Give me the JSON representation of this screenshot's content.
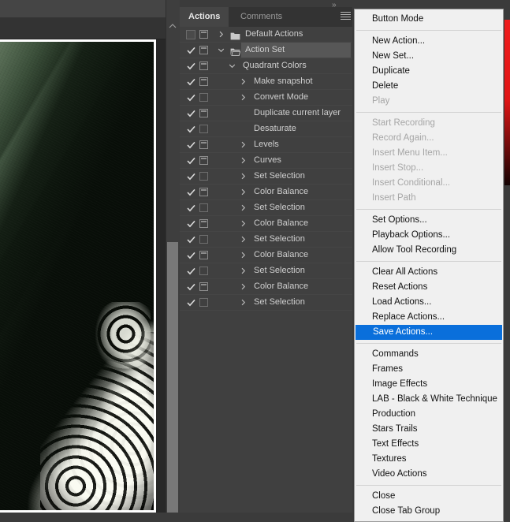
{
  "document": {
    "name": "photoshop-canvas",
    "image_description": "dark green-tinted photograph of angled architectural panels with a lit lattice window"
  },
  "panel": {
    "overflow_icon": "chevron-double-right-icon",
    "menu_icon": "hamburger-menu-icon",
    "tabs": [
      {
        "label": "Actions",
        "active": true
      },
      {
        "label": "Comments",
        "active": false
      }
    ],
    "rows": [
      {
        "label": "Default Actions",
        "depth": 0,
        "checked": false,
        "dialog": "filled",
        "arrow": "right",
        "folder": "closed",
        "selected": false
      },
      {
        "label": "Action Set",
        "depth": 0,
        "checked": true,
        "dialog": "filled",
        "arrow": "down",
        "folder": "open",
        "selected": true
      },
      {
        "label": "Quadrant Colors",
        "depth": 1,
        "checked": true,
        "dialog": "filled",
        "arrow": "down",
        "folder": "none",
        "selected": false
      },
      {
        "label": "Make snapshot",
        "depth": 2,
        "checked": true,
        "dialog": "filled",
        "arrow": "right",
        "folder": "none",
        "selected": false
      },
      {
        "label": "Convert Mode",
        "depth": 2,
        "checked": true,
        "dialog": "empty",
        "arrow": "right",
        "folder": "none",
        "selected": false
      },
      {
        "label": "Duplicate current layer",
        "depth": 2,
        "checked": true,
        "dialog": "filled",
        "arrow": "none",
        "folder": "none",
        "selected": false
      },
      {
        "label": "Desaturate",
        "depth": 2,
        "checked": true,
        "dialog": "empty",
        "arrow": "none",
        "folder": "none",
        "selected": false
      },
      {
        "label": "Levels",
        "depth": 2,
        "checked": true,
        "dialog": "filled",
        "arrow": "right",
        "folder": "none",
        "selected": false
      },
      {
        "label": "Curves",
        "depth": 2,
        "checked": true,
        "dialog": "filled",
        "arrow": "right",
        "folder": "none",
        "selected": false
      },
      {
        "label": "Set Selection",
        "depth": 2,
        "checked": true,
        "dialog": "empty",
        "arrow": "right",
        "folder": "none",
        "selected": false
      },
      {
        "label": "Color Balance",
        "depth": 2,
        "checked": true,
        "dialog": "filled",
        "arrow": "right",
        "folder": "none",
        "selected": false
      },
      {
        "label": "Set Selection",
        "depth": 2,
        "checked": true,
        "dialog": "empty",
        "arrow": "right",
        "folder": "none",
        "selected": false
      },
      {
        "label": "Color Balance",
        "depth": 2,
        "checked": true,
        "dialog": "filled",
        "arrow": "right",
        "folder": "none",
        "selected": false
      },
      {
        "label": "Set Selection",
        "depth": 2,
        "checked": true,
        "dialog": "empty",
        "arrow": "right",
        "folder": "none",
        "selected": false
      },
      {
        "label": "Color Balance",
        "depth": 2,
        "checked": true,
        "dialog": "filled",
        "arrow": "right",
        "folder": "none",
        "selected": false
      },
      {
        "label": "Set Selection",
        "depth": 2,
        "checked": true,
        "dialog": "empty",
        "arrow": "right",
        "folder": "none",
        "selected": false
      },
      {
        "label": "Color Balance",
        "depth": 2,
        "checked": true,
        "dialog": "filled",
        "arrow": "right",
        "folder": "none",
        "selected": false
      },
      {
        "label": "Set Selection",
        "depth": 2,
        "checked": true,
        "dialog": "empty",
        "arrow": "right",
        "folder": "none",
        "selected": false
      }
    ]
  },
  "scrollbar": {
    "collapse_icon": "chevron-up-icon"
  },
  "context_menu": {
    "highlight_color": "#0a6fdb",
    "background_color": "#f0f0f0",
    "items": [
      {
        "label": "Button Mode",
        "state": "normal"
      },
      {
        "type": "separator"
      },
      {
        "label": "New Action...",
        "state": "normal"
      },
      {
        "label": "New Set...",
        "state": "normal"
      },
      {
        "label": "Duplicate",
        "state": "normal"
      },
      {
        "label": "Delete",
        "state": "normal"
      },
      {
        "label": "Play",
        "state": "disabled"
      },
      {
        "type": "separator"
      },
      {
        "label": "Start Recording",
        "state": "disabled"
      },
      {
        "label": "Record Again...",
        "state": "disabled"
      },
      {
        "label": "Insert Menu Item...",
        "state": "disabled"
      },
      {
        "label": "Insert Stop...",
        "state": "disabled"
      },
      {
        "label": "Insert Conditional...",
        "state": "disabled"
      },
      {
        "label": "Insert Path",
        "state": "disabled"
      },
      {
        "type": "separator"
      },
      {
        "label": "Set Options...",
        "state": "normal"
      },
      {
        "label": "Playback Options...",
        "state": "normal"
      },
      {
        "label": "Allow Tool Recording",
        "state": "normal"
      },
      {
        "type": "separator"
      },
      {
        "label": "Clear All Actions",
        "state": "normal"
      },
      {
        "label": "Reset Actions",
        "state": "normal"
      },
      {
        "label": "Load Actions...",
        "state": "normal"
      },
      {
        "label": "Replace Actions...",
        "state": "normal"
      },
      {
        "label": "Save Actions...",
        "state": "highlighted"
      },
      {
        "type": "separator"
      },
      {
        "label": "Commands",
        "state": "normal"
      },
      {
        "label": "Frames",
        "state": "normal"
      },
      {
        "label": "Image Effects",
        "state": "normal"
      },
      {
        "label": "LAB - Black & White Technique",
        "state": "normal"
      },
      {
        "label": "Production",
        "state": "normal"
      },
      {
        "label": "Stars Trails",
        "state": "normal"
      },
      {
        "label": "Text Effects",
        "state": "normal"
      },
      {
        "label": "Textures",
        "state": "normal"
      },
      {
        "label": "Video Actions",
        "state": "normal"
      },
      {
        "type": "separator"
      },
      {
        "label": "Close",
        "state": "normal"
      },
      {
        "label": "Close Tab Group",
        "state": "normal"
      }
    ]
  }
}
